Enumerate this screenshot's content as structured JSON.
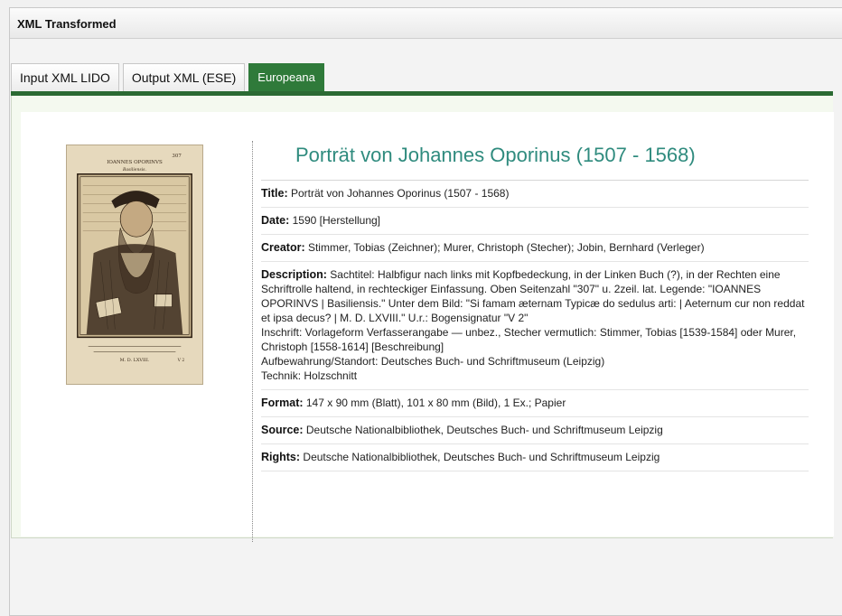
{
  "panel": {
    "title": "XML Transformed"
  },
  "tabs": [
    {
      "label": "Input XML LIDO"
    },
    {
      "label": "Output XML (ESE)"
    },
    {
      "label": "Europeana"
    }
  ],
  "record": {
    "heading": "Porträt von Johannes Oporinus (1507 - 1568)",
    "fields": {
      "title": {
        "label": "Title:",
        "value": "Porträt von Johannes Oporinus (1507 - 1568)"
      },
      "date": {
        "label": "Date:",
        "value": "1590 [Herstellung]"
      },
      "creator": {
        "label": "Creator:",
        "value": "Stimmer, Tobias (Zeichner); Murer, Christoph (Stecher); Jobin, Bernhard (Verleger)"
      },
      "description": {
        "label": "Description:",
        "line1": "Sachtitel: Halbfigur nach links mit Kopfbedeckung, in der Linken Buch (?), in der Rechten eine Schriftrolle haltend, in rechteckiger Einfassung. Oben Seitenzahl \"307\" u. 2zeil. lat. Legende: \"IOANNES OPORINVS | Basiliensis.\" Unter dem Bild: \"Si famam æternam Typicæ do sedulus arti: | Aeternum cur non reddat et ipsa decus? | M. D. LXVIII.\" U.r.: Bogensignatur \"V 2\"",
        "line2": "Inschrift: Vorlageform Verfasserangabe — unbez., Stecher vermutlich: Stimmer, Tobias [1539-1584] oder Murer, Christoph [1558-1614] [Beschreibung]",
        "line3": "Aufbewahrung/Standort: Deutsches Buch- und Schriftmuseum (Leipzig)",
        "line4": "Technik: Holzschnitt"
      },
      "format": {
        "label": "Format:",
        "value": "147 x 90 mm (Blatt), 101 x 80 mm (Bild), 1 Ex.; Papier"
      },
      "source": {
        "label": "Source:",
        "value": "Deutsche Nationalbibliothek, Deutsches Buch- und Schriftmuseum Leipzig"
      },
      "rights": {
        "label": "Rights:",
        "value": "Deutsche Nationalbibliothek, Deutsches Buch- und Schriftmuseum Leipzig"
      }
    }
  },
  "image": {
    "page_number": "307",
    "caption_name": "IOANNES OPORINVS",
    "caption_sub": "Basiliensis.",
    "footer_year": "M. D. LXVIII.",
    "footer_sig": "V 2"
  },
  "colors": {
    "active_tab": "#2f7a3a",
    "heading": "#2f8b7e",
    "tab_rule": "#2b6a33"
  }
}
